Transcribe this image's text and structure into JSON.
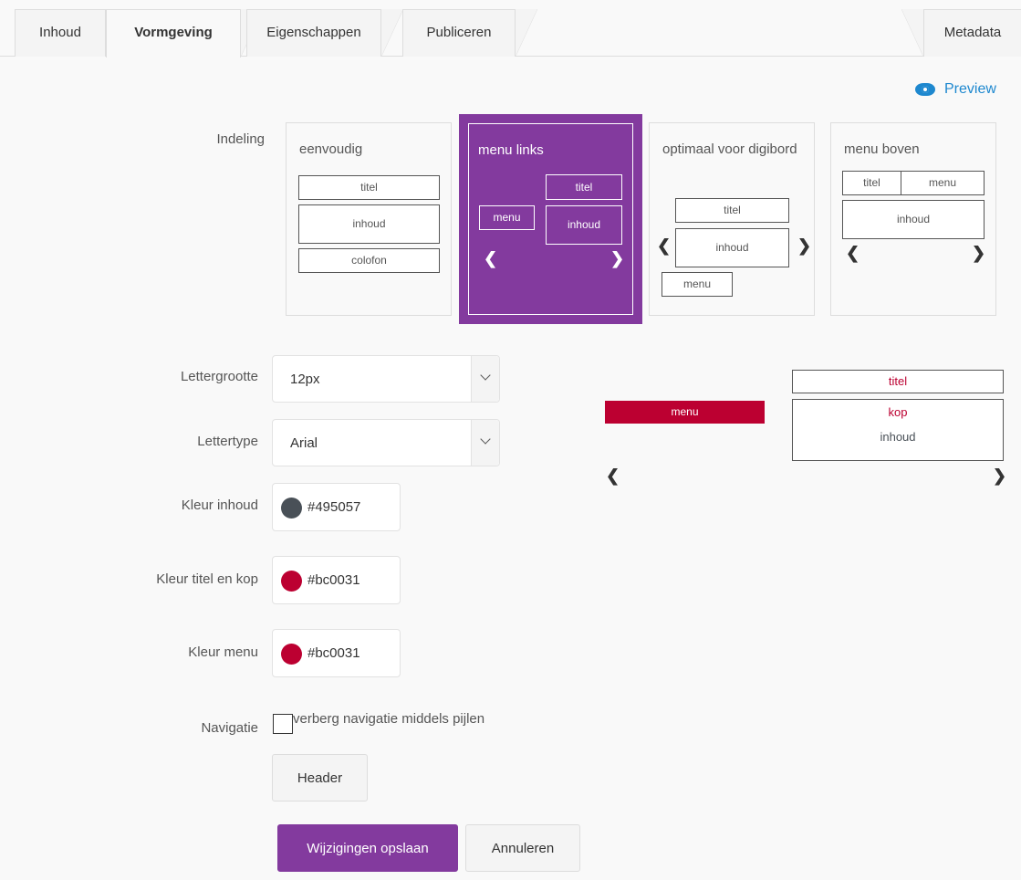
{
  "tabs": [
    {
      "label": "Inhoud",
      "active": false
    },
    {
      "label": "Vormgeving",
      "active": true
    },
    {
      "label": "Eigenschappen",
      "active": false
    },
    {
      "label": "Publiceren",
      "active": false
    }
  ],
  "metadata_tab": "Metadata",
  "preview_link": "Preview",
  "labels": {
    "indeling": "Indeling",
    "lettergrootte": "Lettergrootte",
    "lettertype": "Lettertype",
    "kleur_inhoud": "Kleur inhoud",
    "kleur_titel_kop": "Kleur titel en kop",
    "kleur_menu": "Kleur menu",
    "navigatie": "Navigatie"
  },
  "layouts": {
    "eenvoudig": {
      "name": "eenvoudig",
      "titel": "titel",
      "inhoud": "inhoud",
      "colofon": "colofon"
    },
    "menu_links": {
      "name": "menu links",
      "titel": "titel",
      "menu": "menu",
      "inhoud": "inhoud",
      "selected": true
    },
    "digibord": {
      "name": "optimaal voor digibord",
      "titel": "titel",
      "inhoud": "inhoud",
      "menu": "menu"
    },
    "menu_boven": {
      "name": "menu boven",
      "titel": "titel",
      "menu": "menu",
      "inhoud": "inhoud"
    }
  },
  "fields": {
    "font_size": "12px",
    "font_family": "Arial",
    "color_content": {
      "hex": "#495057",
      "swatch": "#495057"
    },
    "color_title": {
      "hex": "#bc0031",
      "swatch": "#bc0031"
    },
    "color_menu": {
      "hex": "#bc0031",
      "swatch": "#bc0031"
    }
  },
  "navigation_checkbox": {
    "label": "verberg navigatie middels pijlen",
    "checked": false
  },
  "buttons": {
    "header": "Header",
    "save": "Wijzigingen opslaan",
    "cancel": "Annuleren"
  },
  "live_preview": {
    "menu": "menu",
    "titel": "titel",
    "kop": "kop",
    "inhoud": "inhoud",
    "title_color": "#bc0031",
    "menu_color": "#bc0031",
    "content_color": "#495057"
  },
  "colors": {
    "accent": "#833a9e",
    "link": "#1e88cf"
  }
}
